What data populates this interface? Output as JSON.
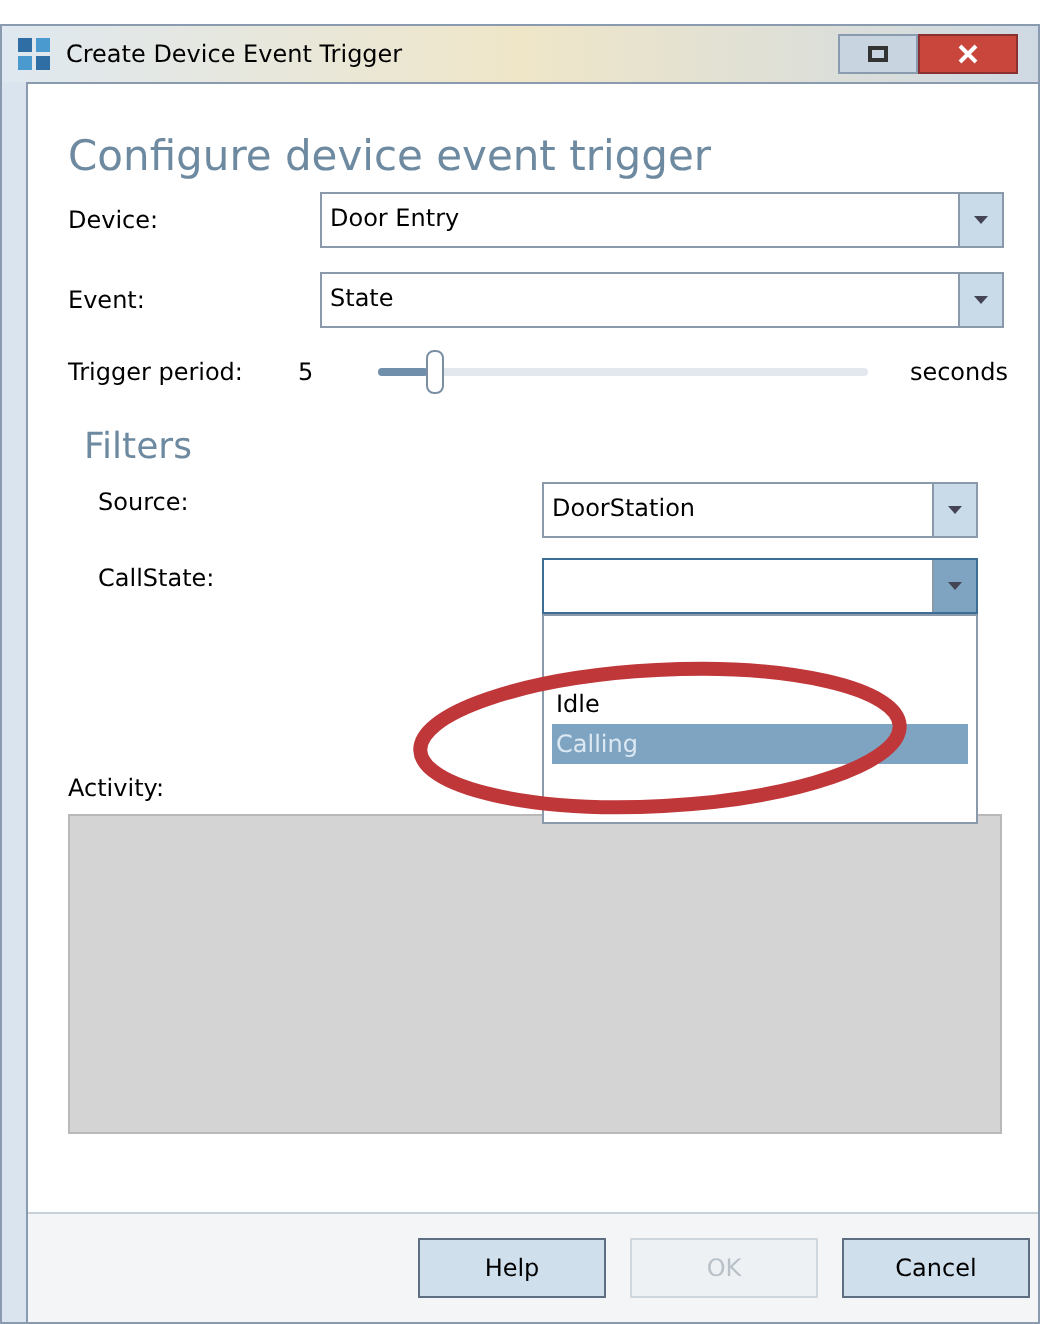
{
  "window": {
    "title": "Create Device Event Trigger"
  },
  "heading": "Configure device event trigger",
  "fields": [
    {
      "label": "Device:",
      "value": "Door Entry"
    },
    {
      "label": "Event:",
      "value": "State"
    }
  ],
  "trigger_period": {
    "label": "Trigger period:",
    "value": "5",
    "level": 0.1,
    "unit": "seconds"
  },
  "filters": {
    "heading": "Filters",
    "fields": [
      {
        "label": "Source:",
        "value": "DoorStation",
        "expanded": false
      },
      {
        "label": "CallState:",
        "expanded": true
      }
    ],
    "dropdown_options": [
      {
        "label": "Idle",
        "selected": false
      },
      {
        "label": "Calling",
        "selected": true
      }
    ]
  },
  "activity": {
    "label": "Activity:"
  },
  "buttons": [
    {
      "label": "Help",
      "disabled": false
    },
    {
      "label": "OK",
      "disabled": true
    },
    {
      "label": "Cancel",
      "disabled": false
    }
  ]
}
